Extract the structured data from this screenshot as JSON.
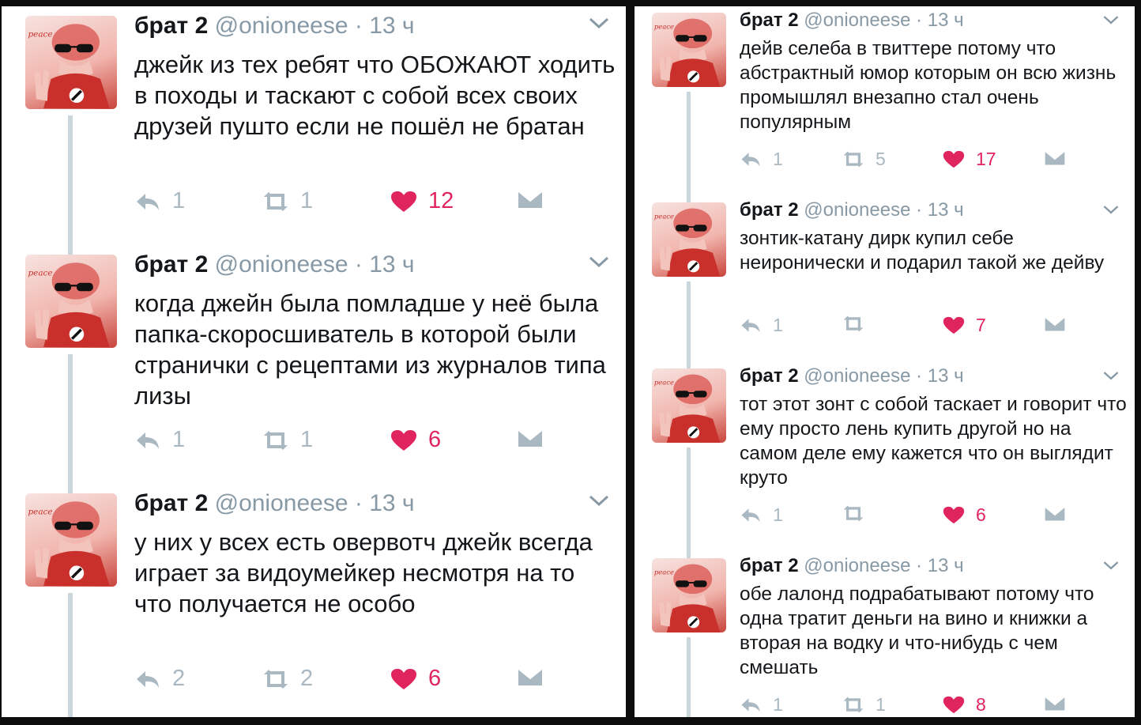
{
  "colors": {
    "like": "#e0245e",
    "muted": "#aab8c2",
    "meta": "#8899a6",
    "text": "#14171a"
  },
  "left_tweets": [
    {
      "name": "брат 2",
      "handle": "@onioneese",
      "dot": "·",
      "time": "13 ч",
      "text": "джейк из тех ребят что ОБОЖАЮТ ходить в походы и таскают с собой всех своих друзей пушто если не пошёл не братан",
      "replies": "1",
      "retweets": "1",
      "likes": "12",
      "avatar_text": "peace"
    },
    {
      "name": "брат 2",
      "handle": "@onioneese",
      "dot": "·",
      "time": "13 ч",
      "text": "когда джейн была помладше у неё была папка-скоросшиватель в которой были странички с рецептами из журналов типа лизы",
      "replies": "1",
      "retweets": "1",
      "likes": "6",
      "avatar_text": "peace"
    },
    {
      "name": "брат 2",
      "handle": "@onioneese",
      "dot": "·",
      "time": "13 ч",
      "text": "у них у всех есть овервотч джейк всегда играет за видоумейкер несмотря на то что получается не особо",
      "replies": "2",
      "retweets": "2",
      "likes": "6",
      "avatar_text": "peace"
    }
  ],
  "right_tweets": [
    {
      "name": "брат 2",
      "handle": "@onioneese",
      "dot": "·",
      "time": "13 ч",
      "text": "дейв селеба в твиттере потому что абстрактный юмор которым он всю жизнь промышлял внезапно стал очень популярным",
      "replies": "1",
      "retweets": "5",
      "likes": "17",
      "avatar_text": "peace"
    },
    {
      "name": "брат 2",
      "handle": "@onioneese",
      "dot": "·",
      "time": "13 ч",
      "text": "зонтик-катану дирк купил себе неиронически и подарил такой же дейву",
      "replies": "1",
      "retweets": "",
      "likes": "7",
      "avatar_text": "peace"
    },
    {
      "name": "брат 2",
      "handle": "@onioneese",
      "dot": "·",
      "time": "13 ч",
      "text": "тот этот зонт с собой таскает и говорит что ему просто лень купить другой но на самом деле ему кажется что он выглядит круто",
      "replies": "1",
      "retweets": "",
      "likes": "6",
      "avatar_text": "peace"
    },
    {
      "name": "брат 2",
      "handle": "@onioneese",
      "dot": "·",
      "time": "13 ч",
      "text": "обе лалонд подрабатывают потому что одна тратит деньги на вино и книжки а вторая на водку и что-нибудь с чем смешать",
      "replies": "1",
      "retweets": "1",
      "likes": "8",
      "avatar_text": "peace"
    }
  ]
}
